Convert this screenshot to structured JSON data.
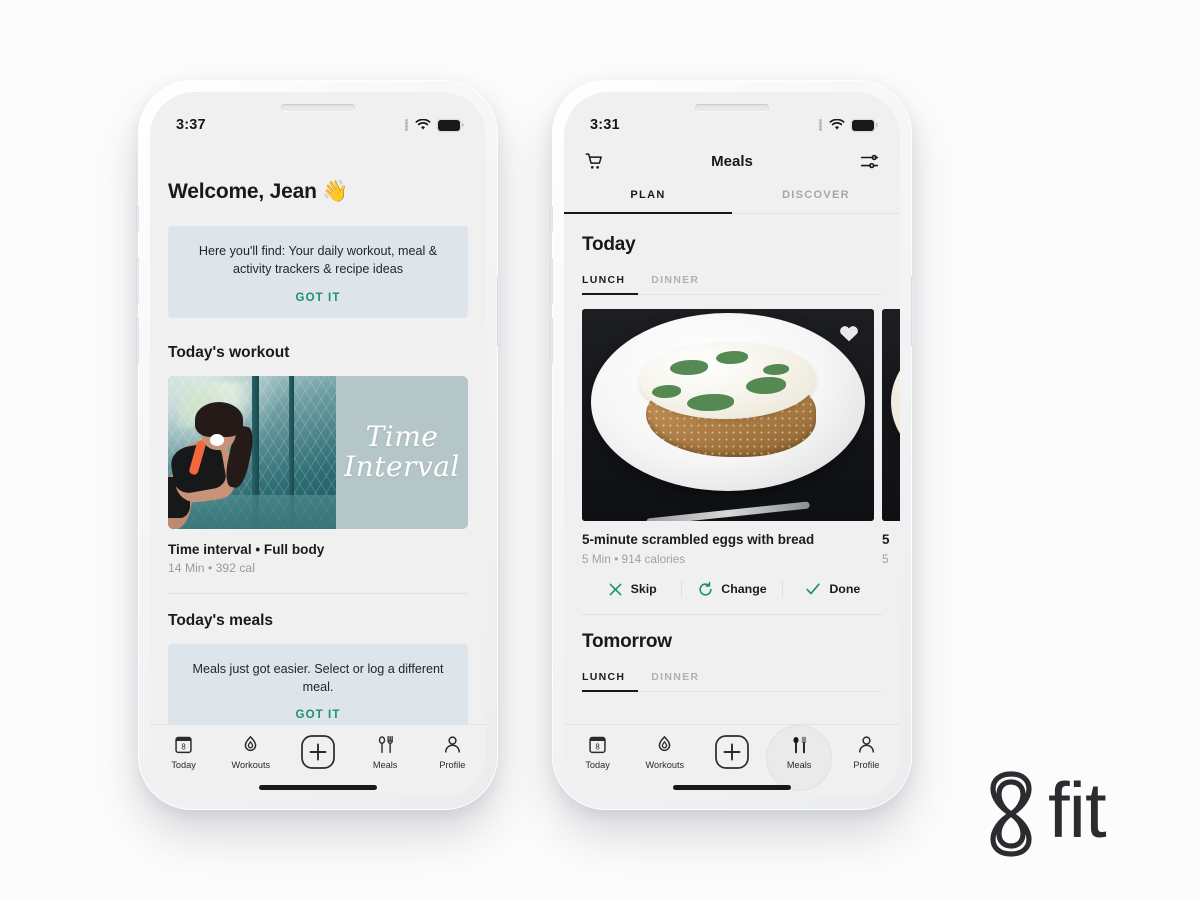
{
  "brand": {
    "logo_text": "fit",
    "logo_mark": "8",
    "accent": "#1a9270",
    "text_dark": "#18191b"
  },
  "left_phone": {
    "status": {
      "time": "3:37",
      "signal_icon": "signal-dots-icon",
      "wifi_icon": "wifi-icon",
      "battery_icon": "battery-icon"
    },
    "greeting": "Welcome, Jean 👋",
    "info_banner": {
      "text": "Here you'll find: Your daily workout, meal & activity trackers & recipe ideas",
      "cta": "GOT IT"
    },
    "workout_section": {
      "heading": "Today's workout",
      "card_script_line1": "Time",
      "card_script_line2": "Interval",
      "title": "Time interval • Full body",
      "meta": "14 Min • 392 cal"
    },
    "meals_section": {
      "heading": "Today's meals",
      "banner_text": "Meals just got easier. Select or log a different meal.",
      "banner_cta": "GOT IT"
    },
    "tabbar": [
      {
        "label": "Today",
        "icon": "calendar-icon",
        "badge": "8",
        "active": false
      },
      {
        "label": "Workouts",
        "icon": "flame-icon",
        "active": false
      },
      {
        "label": "",
        "icon": "plus-icon",
        "active": false
      },
      {
        "label": "Meals",
        "icon": "cutlery-icon",
        "active": false
      },
      {
        "label": "Profile",
        "icon": "person-icon",
        "active": false
      }
    ]
  },
  "right_phone": {
    "status": {
      "time": "3:31",
      "signal_icon": "signal-dots-icon",
      "wifi_icon": "wifi-icon",
      "battery_icon": "battery-icon"
    },
    "nav": {
      "left_icon": "shopping-cart-icon",
      "title": "Meals",
      "right_icon": "filter-sliders-icon"
    },
    "top_tabs": [
      {
        "label": "PLAN",
        "active": true
      },
      {
        "label": "DISCOVER",
        "active": false
      }
    ],
    "today": {
      "heading": "Today",
      "subtabs": [
        {
          "label": "LUNCH",
          "active": true
        },
        {
          "label": "DINNER",
          "active": false
        }
      ],
      "meal": {
        "favorite_icon": "heart-icon",
        "title": "5-minute scrambled eggs with bread",
        "meta": "5 Min • 914 calories",
        "next_card_title_partial": "5",
        "next_card_meta_partial": "5"
      },
      "actions": [
        {
          "label": "Skip",
          "icon": "close-x-icon"
        },
        {
          "label": "Change",
          "icon": "refresh-icon"
        },
        {
          "label": "Done",
          "icon": "check-icon"
        }
      ]
    },
    "tomorrow": {
      "heading": "Tomorrow",
      "subtabs": [
        {
          "label": "LUNCH",
          "active": true
        },
        {
          "label": "DINNER",
          "active": false
        }
      ]
    },
    "tabbar": [
      {
        "label": "Today",
        "icon": "calendar-icon",
        "badge": "8",
        "active": false
      },
      {
        "label": "Workouts",
        "icon": "flame-icon",
        "active": false
      },
      {
        "label": "",
        "icon": "plus-icon",
        "active": false
      },
      {
        "label": "Meals",
        "icon": "cutlery-icon",
        "active": true
      },
      {
        "label": "Profile",
        "icon": "person-icon",
        "active": false
      }
    ]
  }
}
